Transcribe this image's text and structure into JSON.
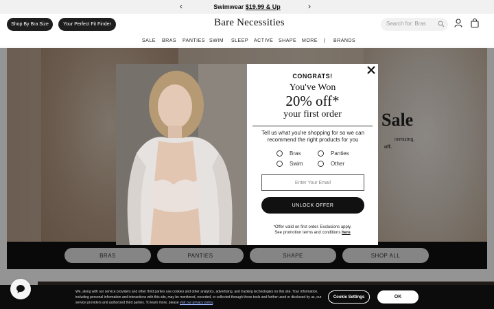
{
  "promo": {
    "text": "Swimwear",
    "price": "$19.99 & Up"
  },
  "header": {
    "bra_size_button": "Shop By Bra Size",
    "fit_finder_button": "Your Perfect Fit Finder",
    "logo": "Bare Necessities",
    "search_placeholder": "Search for: Bras"
  },
  "nav": {
    "items": [
      "SALE",
      "BRAS",
      "PANTIES",
      "SWIM",
      "SLEEP",
      "ACTIVE",
      "SHAPE",
      "MORE",
      "|",
      "BRANDS"
    ]
  },
  "hero": {
    "headline": "Sale",
    "line1": "inimizing,",
    "line2": "off."
  },
  "categories": [
    "BRAS",
    "PANTIES",
    "SHAPE",
    "SHOP ALL"
  ],
  "modal": {
    "congrats": "CONGRATS!",
    "won": "You've Won",
    "offer": "20% off*",
    "first_order": "your first order",
    "prompt": "Tell us what you're shopping for so we can recommend the right products for you",
    "options": [
      "Bras",
      "Panties",
      "Swim",
      "Other"
    ],
    "email_placeholder": "Enter Your Email",
    "cta": "UNLOCK OFFER",
    "fine_print_1": "*Offer valid on first order. Exclusions apply.",
    "fine_print_2": "See promotion terms and conditions",
    "fine_print_link": "here"
  },
  "cookie": {
    "text": "We, along with our service providers and other third parties use cookies and other analytics, advertising, and tracking technologies on this site. Your information, including personal information and interactions with this site, may be monitored, recorded, or collected through these tools and further used or disclosed by us, our service providers and authorized third parties. To learn more, please",
    "link": "visit our privacy policy",
    "settings_button": "Cookie Settings",
    "ok_button": "OK"
  }
}
